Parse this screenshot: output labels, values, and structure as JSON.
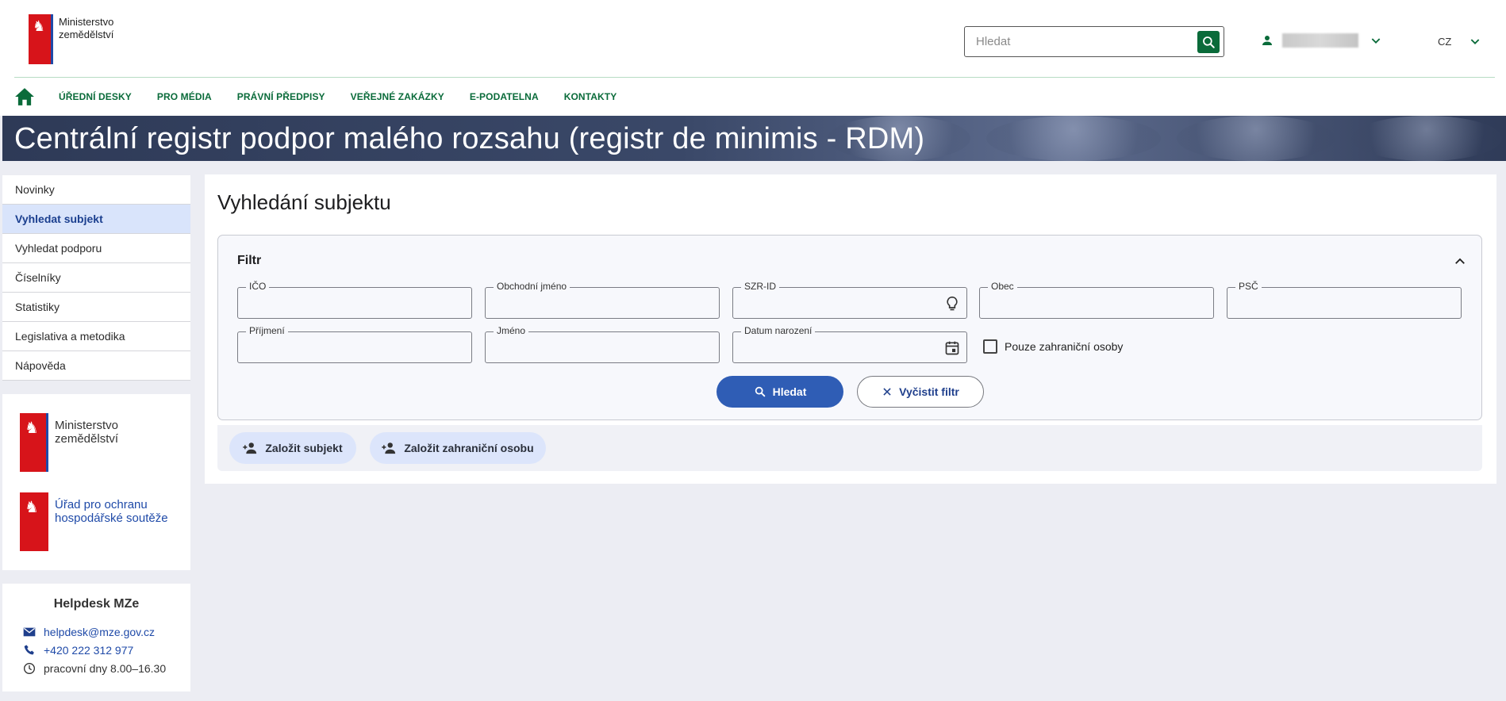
{
  "header": {
    "logo_line1": "Ministerstvo",
    "logo_line2": "zemědělství",
    "search_placeholder": "Hledat",
    "language": "CZ",
    "nav": [
      "ÚŘEDNÍ DESKY",
      "PRO MÉDIA",
      "PRÁVNÍ PŘEDPISY",
      "VEŘEJNÉ ZAKÁZKY",
      "E-PODATELNA",
      "KONTAKTY"
    ]
  },
  "banner": {
    "title": "Centrální registr podpor malého rozsahu (registr de minimis - RDM)"
  },
  "sidebar": {
    "items": [
      {
        "label": "Novinky"
      },
      {
        "label": "Vyhledat subjekt"
      },
      {
        "label": "Vyhledat podporu"
      },
      {
        "label": "Číselníky"
      },
      {
        "label": "Statistiky"
      },
      {
        "label": "Legislativa a metodika"
      },
      {
        "label": "Nápověda"
      }
    ],
    "active_item": "Vyhledat subjekt",
    "partners": [
      {
        "line1": "Ministerstvo",
        "line2": "zemědělství"
      },
      {
        "line1": "Úřad pro ochranu",
        "line2": "hospodářské soutěže"
      }
    ],
    "helpdesk": {
      "title": "Helpdesk MZe",
      "email": "helpdesk@mze.gov.cz",
      "phone": "+420 222 312 977",
      "hours": "pracovní dny 8.00–16.30"
    }
  },
  "main": {
    "title": "Vyhledání subjektu",
    "filter": {
      "title": "Filtr",
      "fields": {
        "ico": "IČO",
        "obchodni_jmeno": "Obchodní jméno",
        "szr_id": "SZR-ID",
        "obec": "Obec",
        "psc": "PSČ",
        "prijmeni": "Příjmení",
        "jmeno": "Jméno",
        "datum_narozeni": "Datum narození"
      },
      "checkbox_label": "Pouze zahraniční osoby",
      "search_button": "Hledat",
      "clear_button": "Vyčistit filtr"
    },
    "actions": {
      "create_subject": "Založit subjekt",
      "create_foreign": "Založit zahraniční osobu"
    }
  },
  "colors": {
    "brand_green": "#0a6b3a",
    "primary_blue": "#2f5db5",
    "flag_red": "#d7141a",
    "active_bg": "#d9e4fb"
  }
}
